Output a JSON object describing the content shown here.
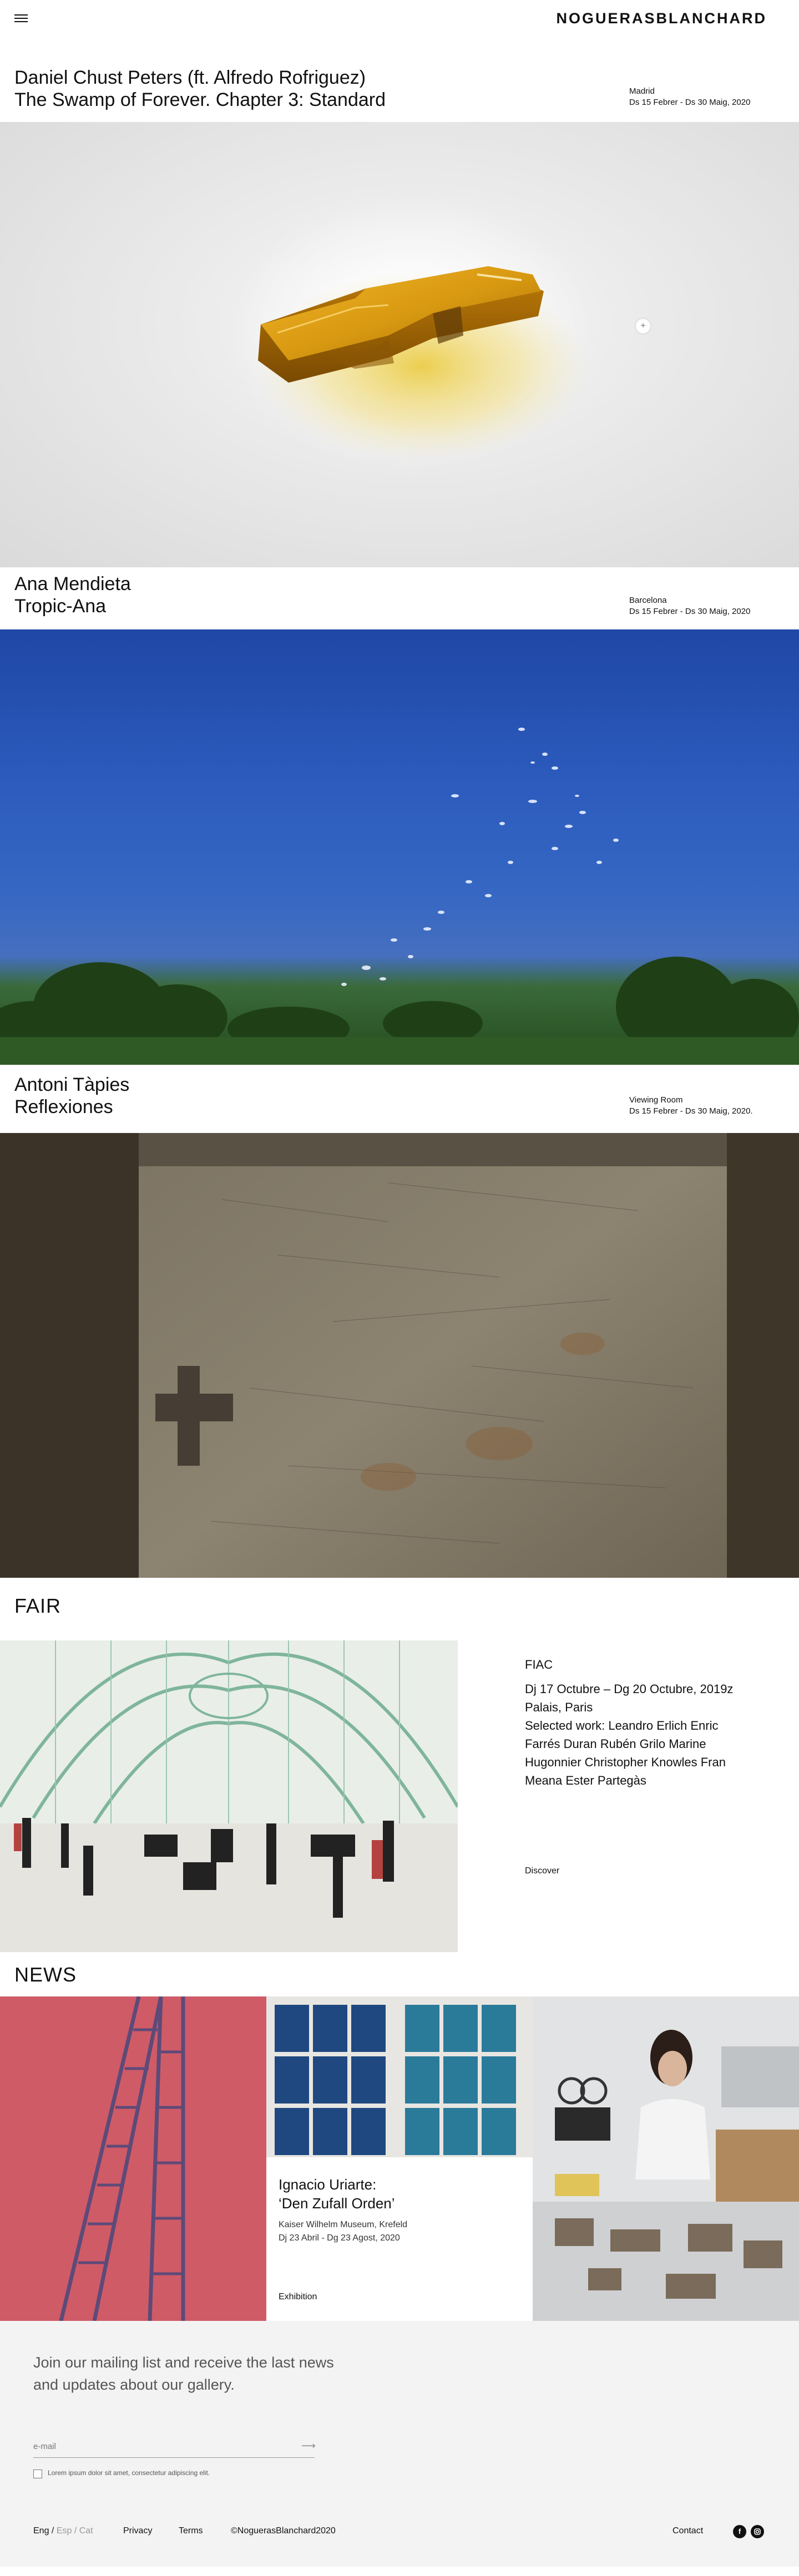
{
  "header": {
    "logo": "NOGUERASBLANCHARD",
    "menu_icon": "hamburger-icon"
  },
  "exhibitions": [
    {
      "artist": "Daniel Chust Peters (ft. Alfredo Rofriguez)",
      "title": "The Swamp of Forever. Chapter 3: Standard",
      "location": "Madrid",
      "dates": "Ds 15 Febrer - Ds 30 Maig, 2020",
      "expand_icon": "plus-icon"
    },
    {
      "artist": "Ana Mendieta",
      "title": "Tropic-Ana",
      "location": "Barcelona",
      "dates": "Ds 15 Febrer - Ds 30 Maig, 2020"
    },
    {
      "artist": "Antoni Tàpies",
      "title": "Reflexiones",
      "location": "Viewing Room",
      "dates": "Ds 15 Febrer - Ds 30 Maig, 2020."
    }
  ],
  "fair": {
    "section_title": "FAIR",
    "name": "FIAC",
    "dates": "Dj 17 Octubre – Dg 20 Octubre, 2019z",
    "venue": "Palais, Paris",
    "selected_work": "Selected work: Leandro Erlich Enric Farrés Duran Rubén Grilo Marine Hugonnier Christopher Knowles Fran Meana Ester Partegàs",
    "discover_label": "Discover"
  },
  "news": {
    "section_title": "NEWS",
    "card": {
      "artist": "Ignacio Uriarte:",
      "title": "‘Den Zufall Orden’",
      "venue": "Kaiser Wilhelm Museum, Krefeld",
      "dates": "Dj 23 Abril - Dg 23 Agost, 2020",
      "type": "Exhibition"
    }
  },
  "mailing": {
    "heading": "Join our mailing list and receive the last news and updates about our gallery.",
    "email_placeholder": "e-mail",
    "submit_icon": "arrow-right-icon",
    "checkbox_label": "Lorem ipsum dolor sit amet, consectetur adipiscing elit."
  },
  "footer": {
    "lang_en": "Eng",
    "lang_sep1": " / ",
    "lang_es": "Esp",
    "lang_sep2": " / ",
    "lang_ca": "Cat",
    "privacy": "Privacy",
    "terms": "Terms",
    "copyright": "©NoguerasBlanchard2020",
    "contact": "Contact",
    "facebook_icon": "facebook-icon",
    "instagram_icon": "instagram-icon"
  },
  "colors": {
    "accent_red": "#cf5b67",
    "sky_blue": "#2c5bbd",
    "amber": "#d99a12"
  }
}
